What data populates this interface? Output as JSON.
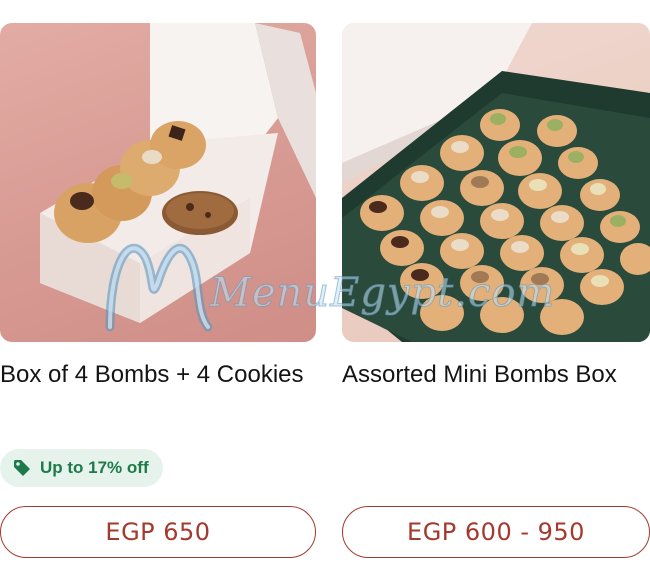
{
  "products": [
    {
      "title": "Box of 4 Bombs + 4 Cookies",
      "badge": {
        "label": "Up to 17% off",
        "icon": "tag-icon",
        "color": "#1d7a4a"
      },
      "price": "EGP 650"
    },
    {
      "title": "Assorted Mini Bombs Box",
      "price": "EGP 600 - 950"
    }
  ],
  "watermark": {
    "text": "MenuEgypt.com"
  },
  "colors": {
    "accent": "#a33a2d",
    "badge_bg": "#e6f3ec",
    "badge_text": "#1d7a4a"
  }
}
